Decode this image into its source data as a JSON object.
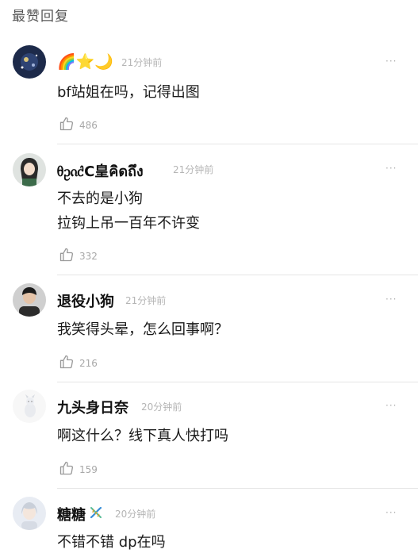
{
  "section_title": "最赞回复",
  "more_label": "···",
  "comments": [
    {
      "emoji": "🌈⭐🌙",
      "time": "21分钟前",
      "lines": [
        "bf站姐在吗，记得出图"
      ],
      "likes": "486"
    },
    {
      "name": "ᦲᦳᦵᦺC皇คิดถึง",
      "time": "21分钟前",
      "lines": [
        "不去的是小狗",
        "拉钩上吊一百年不许变"
      ],
      "likes": "332"
    },
    {
      "name": "退役小狗",
      "time": "21分钟前",
      "lines": [
        "我笑得头晕，怎么回事啊？"
      ],
      "likes": "216"
    },
    {
      "name": "九头身日奈",
      "time": "20分钟前",
      "lines": [
        "啊这什么？线下真人快打吗"
      ],
      "likes": "159"
    },
    {
      "name": "糖糖",
      "time": "20分钟前",
      "lines": [
        "不错不错 dp在吗"
      ],
      "likes": ""
    }
  ]
}
